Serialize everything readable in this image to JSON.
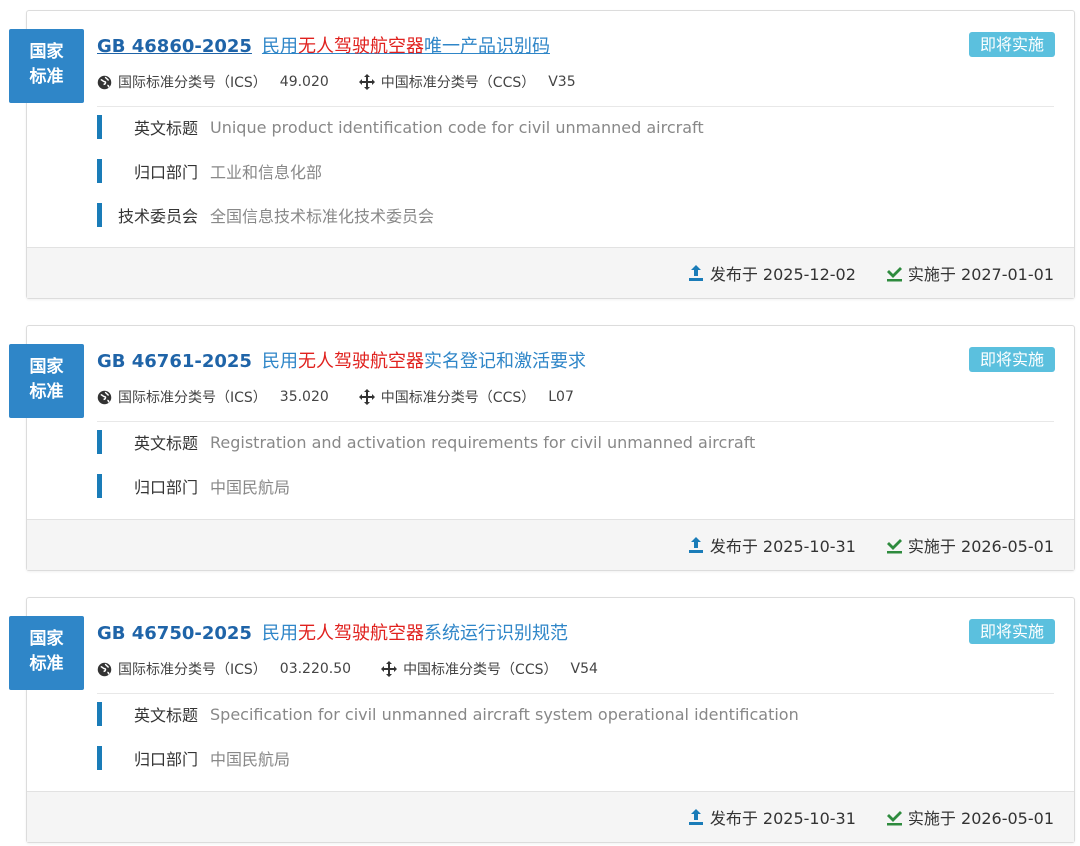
{
  "cards": [
    {
      "badge": [
        "国家",
        "标准"
      ],
      "code": "GB 46860-2025",
      "name_pre": "民用",
      "name_hl": "无人驾驶航空器",
      "name_post": "唯一产品识别码",
      "status": "即将实施",
      "ics_label": "国际标准分类号（ICS）",
      "ics_value": "49.020",
      "ccs_label": "中国标准分类号（CCS）",
      "ccs_value": "V35",
      "fields": [
        {
          "label": "英文标题",
          "value": "Unique product identification code for civil unmanned aircraft"
        },
        {
          "label": "归口部门",
          "value": "工业和信息化部"
        },
        {
          "label": "技术委员会",
          "value": "全国信息技术标准化技术委员会"
        }
      ],
      "published": "发布于 2025-12-02",
      "effective": "实施于 2027-01-01"
    },
    {
      "badge": [
        "国家",
        "标准"
      ],
      "code": "GB 46761-2025",
      "name_pre": "民用",
      "name_hl": "无人驾驶航空器",
      "name_post": "实名登记和激活要求",
      "status": "即将实施",
      "ics_label": "国际标准分类号（ICS）",
      "ics_value": "35.020",
      "ccs_label": "中国标准分类号（CCS）",
      "ccs_value": "L07",
      "fields": [
        {
          "label": "英文标题",
          "value": "Registration and activation requirements for civil unmanned aircraft"
        },
        {
          "label": "归口部门",
          "value": "中国民航局"
        }
      ],
      "published": "发布于 2025-10-31",
      "effective": "实施于 2026-05-01"
    },
    {
      "badge": [
        "国家",
        "标准"
      ],
      "code": "GB 46750-2025",
      "name_pre": "民用",
      "name_hl": "无人驾驶航空器",
      "name_post": "系统运行识别规范",
      "status": "即将实施",
      "ics_label": "国际标准分类号（ICS）",
      "ics_value": "03.220.50",
      "ccs_label": "中国标准分类号（CCS）",
      "ccs_value": "V54",
      "fields": [
        {
          "label": "英文标题",
          "value": "Specification for civil unmanned aircraft system operational identification"
        },
        {
          "label": "归口部门",
          "value": "中国民航局"
        }
      ],
      "published": "发布于 2025-10-31",
      "effective": "实施于 2026-05-01"
    }
  ],
  "icons": {
    "globe": "globe-icon",
    "move": "crosshair-move-icon",
    "upload": "upload-icon",
    "check": "check-icon"
  },
  "colors": {
    "badge": "#2f86c8",
    "status": "#5bc0de",
    "code": "#1f64a8",
    "highlight": "#e0211e",
    "field_bar": "#1a7cb8"
  }
}
